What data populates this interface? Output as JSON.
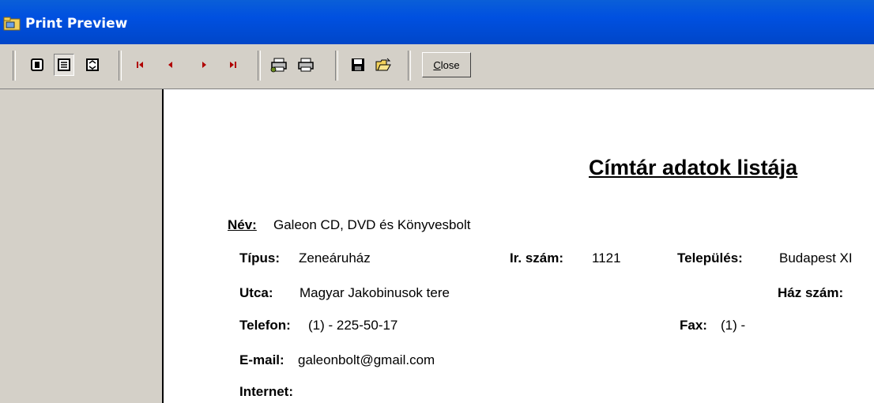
{
  "window": {
    "title": "Print Preview"
  },
  "toolbar": {
    "close_label_accel": "C",
    "close_label_rest": "lose",
    "buttons": [
      "one-page-icon",
      "multi-page-icon",
      "zoom-fit-icon",
      "first-page-icon",
      "prev-page-icon",
      "next-page-icon",
      "last-page-icon",
      "print-setup-icon",
      "print-icon",
      "save-icon",
      "open-icon"
    ]
  },
  "report": {
    "title": "Címtár adatok listája",
    "name_label": "Név:",
    "name_value": "Galeon CD, DVD és Könyvesbolt",
    "type_label": "Típus:",
    "type_value": "Zeneáruház",
    "zip_label": "Ir. szám:",
    "zip_value": "1121",
    "city_label": "Település:",
    "city_value": "Budapest XI",
    "street_label": "Utca:",
    "street_value": "Magyar Jakobinusok tere",
    "house_label": "Ház szám:",
    "phone_label": "Telefon:",
    "phone_value": "(1) - 225-50-17",
    "fax_label": "Fax:",
    "fax_value": "(1) -",
    "email_label": "E-mail:",
    "email_value": "galeonbolt@gmail.com",
    "internet_label": "Internet:"
  }
}
